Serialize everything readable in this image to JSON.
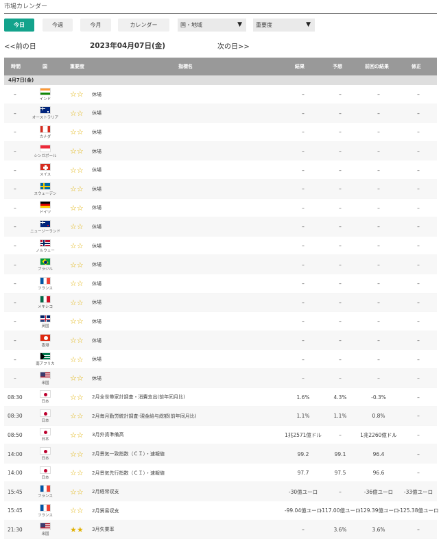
{
  "page_title": "市場カレンダー",
  "toolbar": {
    "today": "今日",
    "week": "今週",
    "month": "今月",
    "calendar": "カレンダー",
    "country_select": "国・地域",
    "importance_select": "重要度"
  },
  "nav": {
    "prev": "<<前の日",
    "current": "2023年04月07日(金)",
    "next": "次の日>>"
  },
  "columns": {
    "time": "時間",
    "country": "国",
    "importance": "重要度",
    "indicator": "指標名",
    "result": "結果",
    "forecast": "予想",
    "previous": "前回の結果",
    "revision": "修正"
  },
  "group_label": "4月7日(金)",
  "colors": {
    "accent": "#13a38c",
    "header": "#999999",
    "star": "#e0b000"
  },
  "rows": [
    {
      "time": "–",
      "country": "インド",
      "flag": "in",
      "stars": "☆☆",
      "indicator": "休場",
      "result": "–",
      "forecast": "–",
      "previous": "–",
      "revision": "–"
    },
    {
      "time": "–",
      "country": "オーストラリア",
      "flag": "au",
      "stars": "☆☆",
      "indicator": "休場",
      "result": "–",
      "forecast": "–",
      "previous": "–",
      "revision": "–"
    },
    {
      "time": "–",
      "country": "カナダ",
      "flag": "ca",
      "stars": "☆☆",
      "indicator": "休場",
      "result": "–",
      "forecast": "–",
      "previous": "–",
      "revision": "–"
    },
    {
      "time": "–",
      "country": "シンガポール",
      "flag": "sg",
      "stars": "☆☆",
      "indicator": "休場",
      "result": "–",
      "forecast": "–",
      "previous": "–",
      "revision": "–"
    },
    {
      "time": "–",
      "country": "スイス",
      "flag": "ch",
      "stars": "☆☆",
      "indicator": "休場",
      "result": "–",
      "forecast": "–",
      "previous": "–",
      "revision": "–"
    },
    {
      "time": "–",
      "country": "スウェーデン",
      "flag": "se",
      "stars": "☆☆",
      "indicator": "休場",
      "result": "–",
      "forecast": "–",
      "previous": "–",
      "revision": "–"
    },
    {
      "time": "–",
      "country": "ドイツ",
      "flag": "de",
      "stars": "☆☆",
      "indicator": "休場",
      "result": "–",
      "forecast": "–",
      "previous": "–",
      "revision": "–"
    },
    {
      "time": "–",
      "country": "ニュージーランド",
      "flag": "nz",
      "stars": "☆☆",
      "indicator": "休場",
      "result": "–",
      "forecast": "–",
      "previous": "–",
      "revision": "–"
    },
    {
      "time": "–",
      "country": "ノルウェー",
      "flag": "no",
      "stars": "☆☆",
      "indicator": "休場",
      "result": "–",
      "forecast": "–",
      "previous": "–",
      "revision": "–"
    },
    {
      "time": "–",
      "country": "ブラジル",
      "flag": "br",
      "stars": "☆☆",
      "indicator": "休場",
      "result": "–",
      "forecast": "–",
      "previous": "–",
      "revision": "–"
    },
    {
      "time": "–",
      "country": "フランス",
      "flag": "fr",
      "stars": "☆☆",
      "indicator": "休場",
      "result": "–",
      "forecast": "–",
      "previous": "–",
      "revision": "–"
    },
    {
      "time": "–",
      "country": "メキシコ",
      "flag": "mx",
      "stars": "☆☆",
      "indicator": "休場",
      "result": "–",
      "forecast": "–",
      "previous": "–",
      "revision": "–"
    },
    {
      "time": "–",
      "country": "英国",
      "flag": "gb",
      "stars": "☆☆",
      "indicator": "休場",
      "result": "–",
      "forecast": "–",
      "previous": "–",
      "revision": "–"
    },
    {
      "time": "–",
      "country": "香港",
      "flag": "hk",
      "stars": "☆☆",
      "indicator": "休場",
      "result": "–",
      "forecast": "–",
      "previous": "–",
      "revision": "–"
    },
    {
      "time": "–",
      "country": "南アフリカ",
      "flag": "za",
      "stars": "☆☆",
      "indicator": "休場",
      "result": "–",
      "forecast": "–",
      "previous": "–",
      "revision": "–"
    },
    {
      "time": "–",
      "country": "米国",
      "flag": "us",
      "stars": "☆☆",
      "indicator": "休場",
      "result": "–",
      "forecast": "–",
      "previous": "–",
      "revision": "–"
    },
    {
      "time": "08:30",
      "country": "日本",
      "flag": "jp",
      "stars": "☆☆",
      "indicator": "2月全世帯家計調査・消費支出(前年同月比)",
      "result": "1.6%",
      "forecast": "4.3%",
      "previous": "-0.3%",
      "revision": "–"
    },
    {
      "time": "08:30",
      "country": "日本",
      "flag": "jp",
      "stars": "☆☆",
      "indicator": "2月毎月勤労統計調査-現金給与総額(前年同月比)",
      "result": "1.1%",
      "forecast": "1.1%",
      "previous": "0.8%",
      "revision": "–"
    },
    {
      "time": "08:50",
      "country": "日本",
      "flag": "jp",
      "stars": "☆☆",
      "indicator": "3月外貨準備高",
      "result": "1兆2571億ドル",
      "forecast": "–",
      "previous": "1兆2260億ドル",
      "revision": "–"
    },
    {
      "time": "14:00",
      "country": "日本",
      "flag": "jp",
      "stars": "☆☆",
      "indicator": "2月景気一致指数（ＣＩ）・速報値",
      "result": "99.2",
      "forecast": "99.1",
      "previous": "96.4",
      "revision": "–"
    },
    {
      "time": "14:00",
      "country": "日本",
      "flag": "jp",
      "stars": "☆☆",
      "indicator": "2月景気先行指数（ＣＩ）・速報値",
      "result": "97.7",
      "forecast": "97.5",
      "previous": "96.6",
      "revision": "–"
    },
    {
      "time": "15:45",
      "country": "フランス",
      "flag": "fr",
      "stars": "☆☆",
      "indicator": "2月経常収支",
      "result": "-30億ユーロ",
      "forecast": "–",
      "previous": "-36億ユーロ",
      "revision": "-33億ユーロ"
    },
    {
      "time": "15:45",
      "country": "フランス",
      "flag": "fr",
      "stars": "☆☆",
      "indicator": "2月貿易収支",
      "result": "-99.04億ユーロ",
      "forecast": "-117.00億ユーロ",
      "previous": "-129.39億ユーロ",
      "revision": "-125.38億ユーロ"
    },
    {
      "time": "21:30",
      "country": "米国",
      "flag": "us",
      "stars": "★★",
      "indicator": "3月失業率",
      "result": "–",
      "forecast": "3.6%",
      "previous": "3.6%",
      "revision": "–"
    }
  ]
}
